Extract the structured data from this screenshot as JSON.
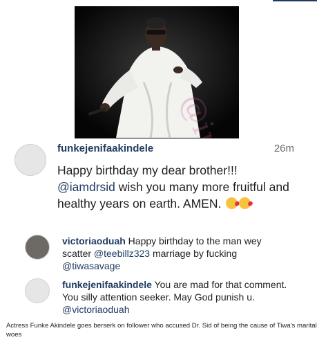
{
  "watermark": "@instablog9ja",
  "comments": [
    {
      "username": "funkejenifaakindele",
      "time": "26m",
      "text_before": "Happy birthday my dear brother!!! ",
      "mention": "@iamdrsid",
      "text_after": " wish you many more fruitful and healthy years on earth. AMEN."
    },
    {
      "username": "victoriaoduah",
      "text_before": " Happy birthday to the man wey scatter ",
      "mention1": "@teebillz323",
      "text_middle": " marriage by fucking ",
      "mention2": "@tiwasavage"
    },
    {
      "username": "funkejenifaakindele",
      "text_before": " You are mad for that comment. You silly attention seeker. May God punish u. ",
      "mention": "@victoriaoduah"
    }
  ],
  "caption": "Actress Funke Akindele goes berserk on follower who accused Dr. Sid of being the cause of Tiwa's marital woes",
  "colors": {
    "username": "#203c62",
    "watermark": "#c8579b",
    "accent": "#1f3a5f"
  }
}
